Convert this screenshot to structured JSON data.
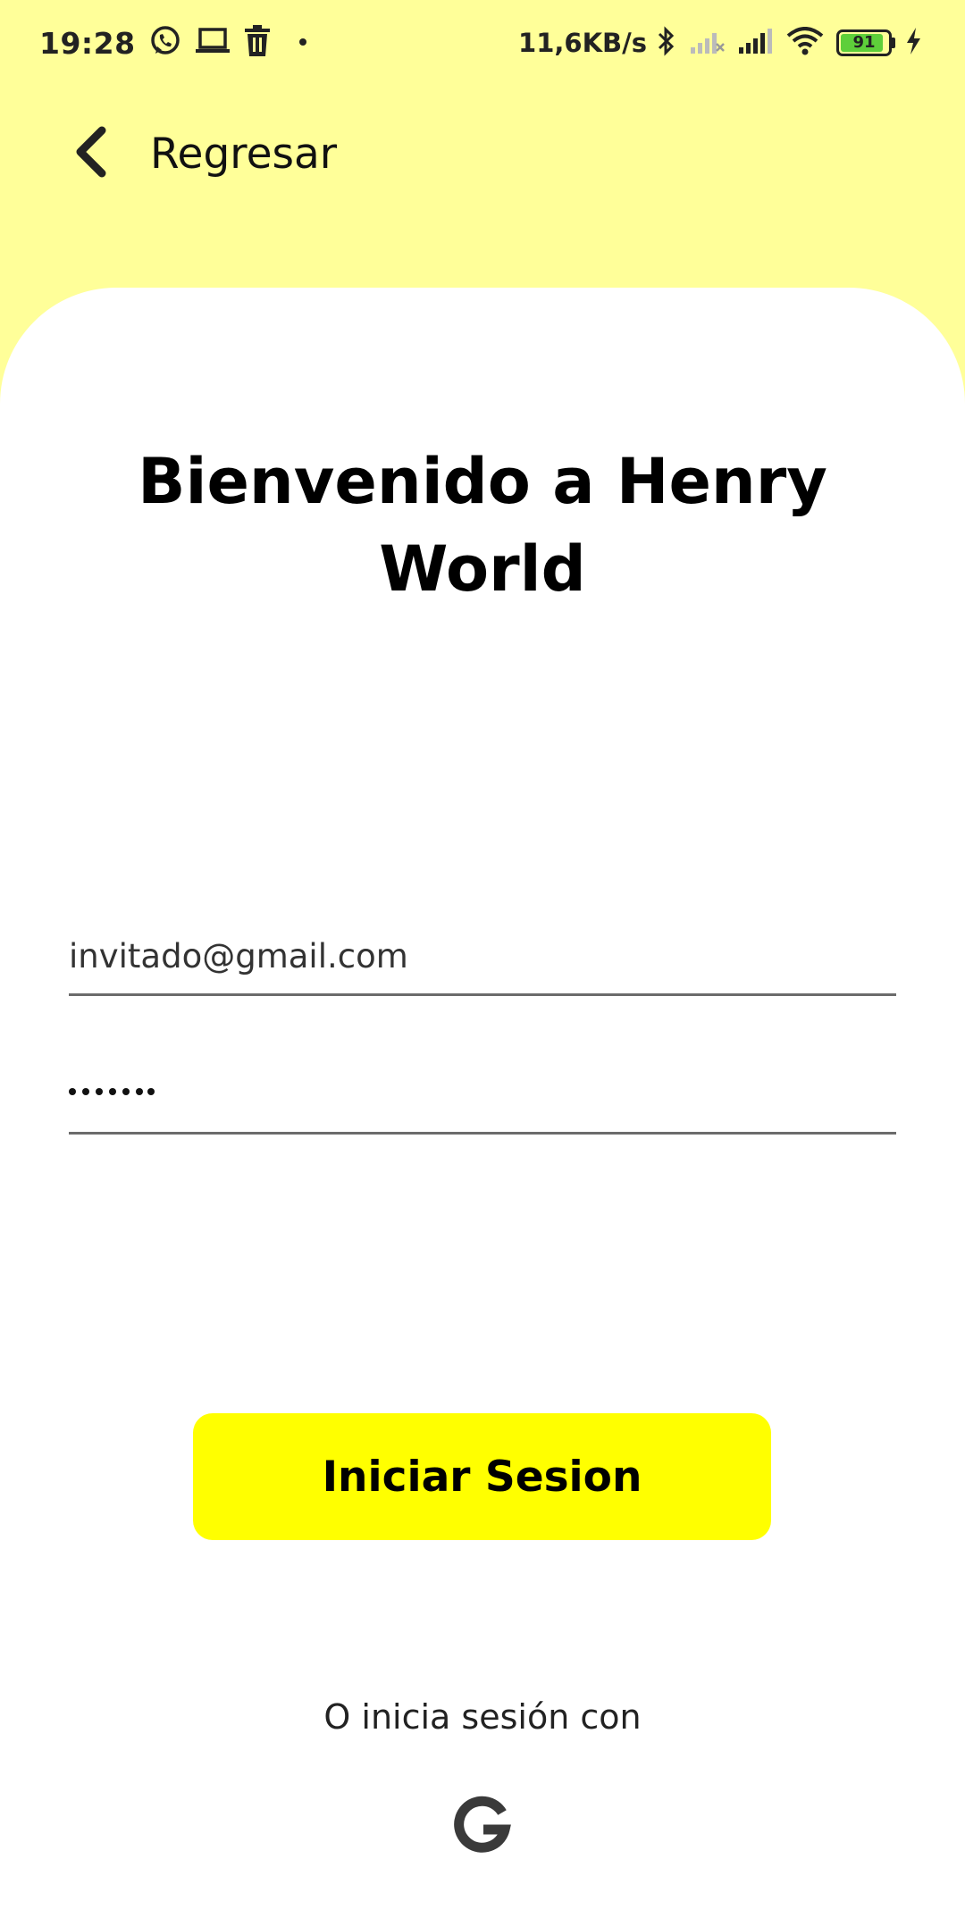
{
  "status_bar": {
    "time": "19:28",
    "net_speed": "11,6KB/s",
    "battery": "91",
    "battery_level": 0.91,
    "icons": [
      "whatsapp-icon",
      "laptop-icon",
      "trash-icon",
      "dot-icon",
      "bluetooth-icon",
      "signal-off-icon",
      "signal-icon",
      "wifi-icon",
      "battery-icon",
      "charging-icon"
    ]
  },
  "header": {
    "back_label": "Regresar",
    "icon": "chevron-left-icon"
  },
  "main": {
    "title": "Bienvenido a Henry World",
    "email_value": "invitado@gmail.com",
    "password_length": 6,
    "login_label": "Iniciar Sesion",
    "alt_login_text": "O inicia sesión con",
    "alt_login_icon": "google-icon"
  },
  "colors": {
    "background": "#ffff99",
    "card": "#ffffff",
    "button": "#ffff00",
    "caret": "#0e8a7a",
    "battery_fill": "#5ecf3a"
  }
}
